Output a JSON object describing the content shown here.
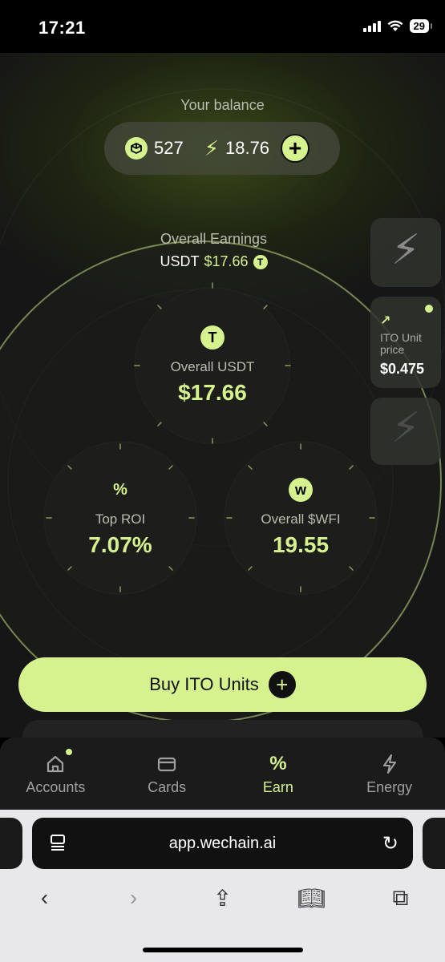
{
  "status": {
    "time": "17:21",
    "battery": "29"
  },
  "balance": {
    "label": "Your balance",
    "points": "527",
    "energy": "18.76",
    "add_icon": "plus-icon"
  },
  "earnings": {
    "label": "Overall Earnings",
    "currency": "USDT",
    "amount": "$17.66"
  },
  "stats": {
    "usdt": {
      "label": "Overall USDT",
      "value": "$17.66"
    },
    "roi": {
      "icon": "%",
      "label": "Top ROI",
      "value": "7.07%"
    },
    "wfi": {
      "icon": "w",
      "label": "Overall $WFI",
      "value": "19.55"
    }
  },
  "side_cards": {
    "ito_label": "ITO Unit price",
    "ito_price": "$0.475"
  },
  "buy_button": {
    "label": "Buy ITO Units"
  },
  "tabs": [
    {
      "label": "Accounts",
      "icon": "home-icon"
    },
    {
      "label": "Cards",
      "icon": "card-icon"
    },
    {
      "label": "Earn",
      "icon": "%"
    },
    {
      "label": "Energy",
      "icon": "bolt-icon"
    }
  ],
  "browser": {
    "url": "app.wechain.ai"
  },
  "colors": {
    "accent": "#d6f28f",
    "background": "#161616"
  }
}
